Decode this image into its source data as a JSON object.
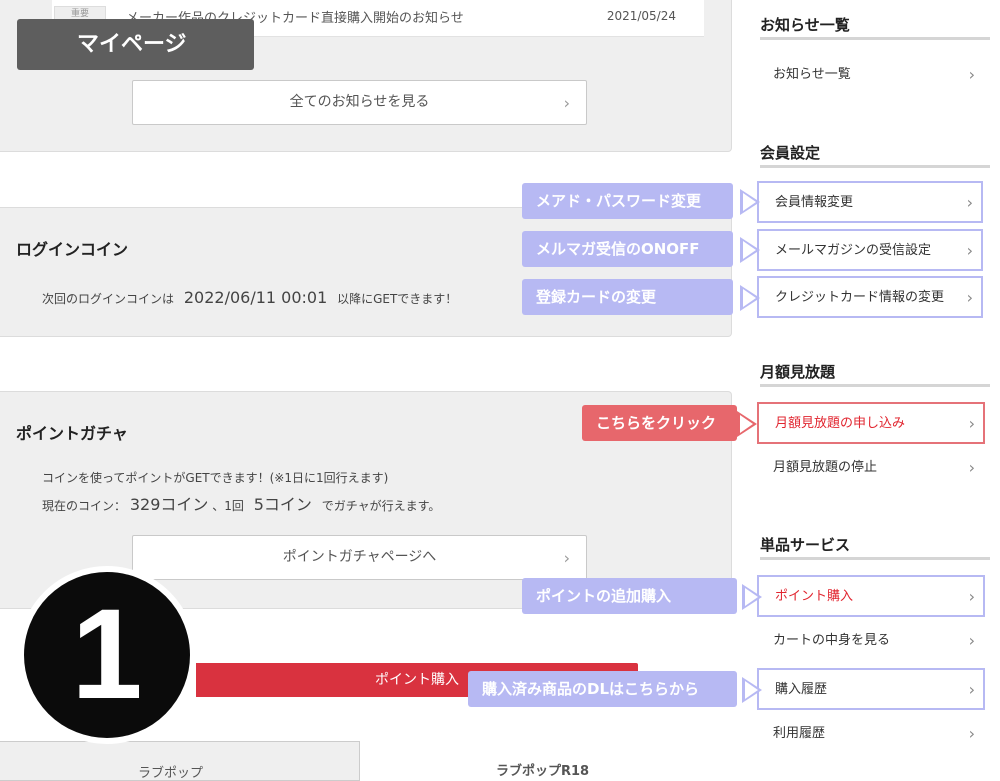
{
  "banner": {
    "label": "マイページ"
  },
  "news": {
    "badge": "重要",
    "item_text": "メーカー作品のクレジットカード直接購入開始のお知らせ",
    "item_date": "2021/05/24",
    "all_button": "全てのお知らせを見る"
  },
  "login_coin": {
    "title": "ログインコイン",
    "prefix": "次回のログインコインは",
    "datetime": "2022/06/11 00:01",
    "suffix": "以降にGETできます！"
  },
  "gacha": {
    "title": "ポイントガチャ",
    "desc": "コインを使ってポイントがGETできます！(※1日に1回行えます)",
    "coin_prefix": "現在のコイン：",
    "coin_value": "329コイン",
    "coin_sep": "、1回",
    "cost_value": "5コイン",
    "coin_suffix": "でガチャが行えます。",
    "page_button": "ポイントガチャページへ"
  },
  "purchase_button": "ポイント購入",
  "tabs": {
    "left": "ラブポップ",
    "right": "ラブポップR18"
  },
  "step_badge": "1",
  "sidebar": {
    "news_head": "お知らせ一覧",
    "news_item": "お知らせ一覧",
    "member_head": "会員設定",
    "member_items": [
      "会員情報変更",
      "メールマガジンの受信設定",
      "クレジットカード情報の変更"
    ],
    "monthly_head": "月額見放題",
    "monthly_items": [
      "月額見放題の申し込み",
      "月額見放題の停止"
    ],
    "single_head": "単品サービス",
    "single_items": [
      "ポイント購入",
      "カートの中身を見る",
      "購入履歴",
      "利用履歴"
    ]
  },
  "callouts": {
    "email_password": "メアド・パスワード変更",
    "newsletter": "メルマガ受信のONOFF",
    "card": "登録カードの変更",
    "click_here": "こちらをクリック",
    "add_points": "ポイントの追加購入",
    "downloads": "購入済み商品のDLはこちらから"
  },
  "colors": {
    "callout_blue": "#b7b9f3",
    "callout_red": "#e7676c",
    "purchase_red": "#d9323f",
    "banner_gray": "#5e5e5e"
  }
}
